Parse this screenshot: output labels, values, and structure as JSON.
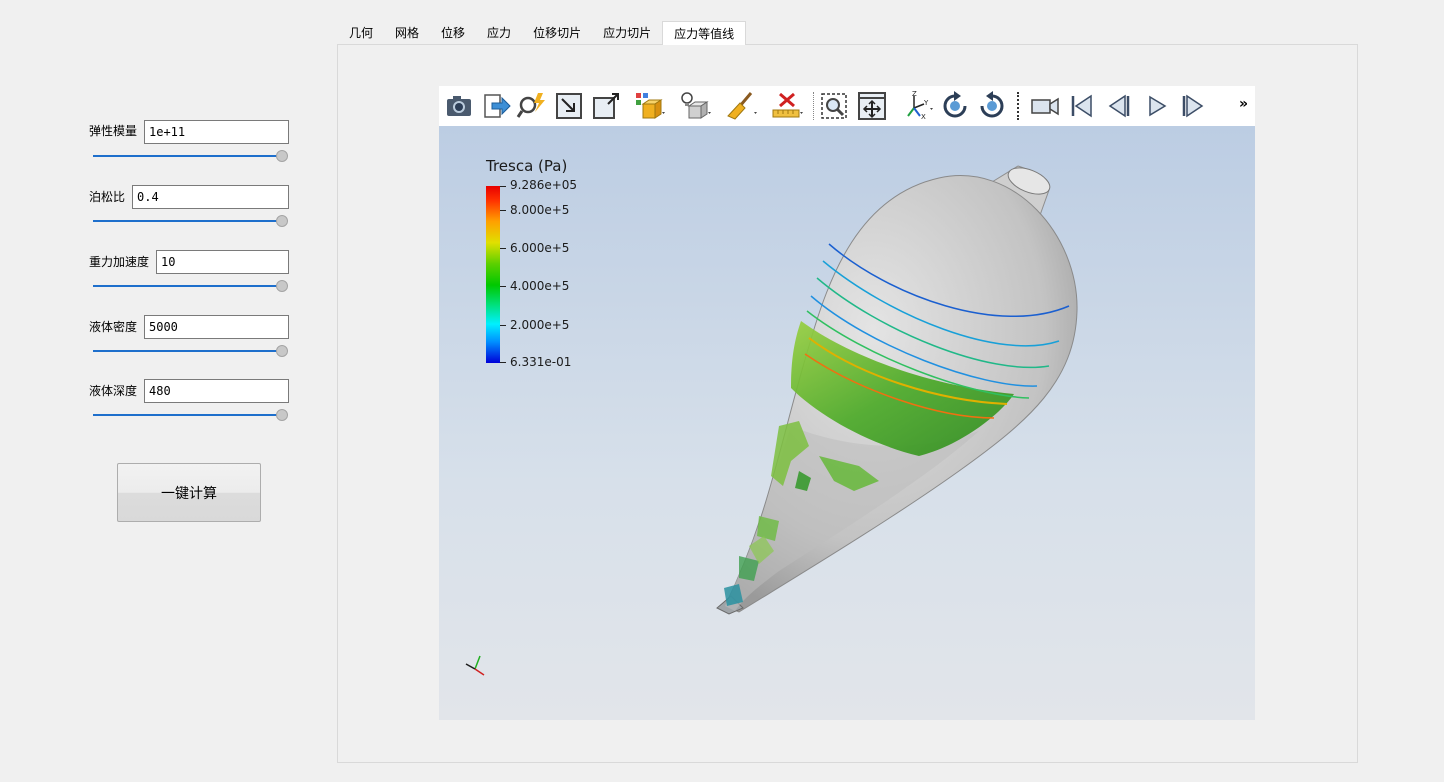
{
  "params": [
    {
      "label": "弹性模量",
      "value": "1e+11"
    },
    {
      "label": "泊松比",
      "value": "0.4"
    },
    {
      "label": "重力加速度",
      "value": "10"
    },
    {
      "label": "液体密度",
      "value": "5000"
    },
    {
      "label": "液体深度",
      "value": "480"
    }
  ],
  "sliders": [
    1.0,
    1.0,
    1.0,
    1.0,
    1.0
  ],
  "calc_button": "一键计算",
  "tabs": [
    "几何",
    "网格",
    "位移",
    "应力",
    "位移切片",
    "应力切片",
    "应力等值线"
  ],
  "active_tab": "应力等值线",
  "toolbar": {
    "icons": [
      "camera-icon",
      "export-icon",
      "find-data-icon",
      "reset-camera-icon",
      "zoom-to-data-icon",
      "toggle-view-icon",
      "light-kit-icon",
      "clear-icon",
      "ruler-icon",
      "zoom-to-box-icon",
      "interaction-mode-icon",
      "orientation-axes-icon",
      "rotate-ccw-icon",
      "rotate-cw-icon",
      "camera-link-icon",
      "first-frame-icon",
      "previous-frame-icon",
      "play-icon",
      "last-frame-icon"
    ],
    "more": "»"
  },
  "colorbar": {
    "title": "Tresca (Pa)",
    "labels": [
      "9.286e+05",
      "8.000e+5",
      "6.000e+5",
      "4.000e+5",
      "2.000e+5",
      "6.331e-01"
    ],
    "max": 928600,
    "min": 0.6331,
    "tick_values": [
      928600,
      800000,
      600000,
      400000,
      200000,
      0.6331
    ],
    "colormap": "rainbow"
  },
  "colors": {
    "background_top": "#bccde3",
    "background_bottom": "#e2e5ea",
    "accent": "#1e6fcc"
  }
}
